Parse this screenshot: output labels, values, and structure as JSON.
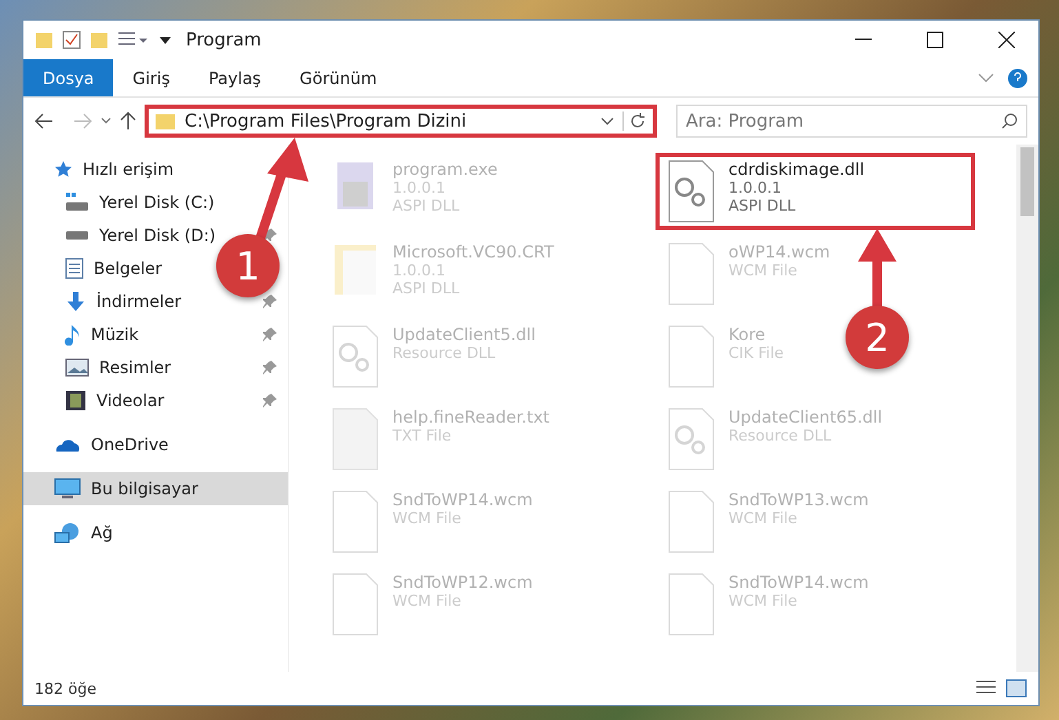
{
  "window": {
    "title": "Program"
  },
  "ribbon_tabs": [
    {
      "label": "Dosya",
      "selected": true
    },
    {
      "label": "Giriş",
      "selected": false
    },
    {
      "label": "Paylaş",
      "selected": false
    },
    {
      "label": "Görünüm",
      "selected": false
    }
  ],
  "address": {
    "value": "C:\\Program Files\\Program Dizini",
    "highlighted": true
  },
  "search": {
    "placeholder": "Ara: Program"
  },
  "sidebar": {
    "items": [
      {
        "label": "Hızlı erişim",
        "kind": "star",
        "selected": false,
        "children": [
          {
            "label": "Yerel Disk (C:)",
            "kind": "drive-windows",
            "pinned": false
          },
          {
            "label": "Yerel Disk (D:)",
            "kind": "drive",
            "pinned": true
          },
          {
            "label": "Belgeler",
            "kind": "document",
            "pinned": false
          },
          {
            "label": "İndirmeler",
            "kind": "download",
            "pinned": true
          },
          {
            "label": "Müzik",
            "kind": "music",
            "pinned": true
          },
          {
            "label": "Resimler",
            "kind": "picture",
            "pinned": true
          },
          {
            "label": "Videolar",
            "kind": "video",
            "pinned": true
          }
        ]
      },
      {
        "label": "OneDrive",
        "kind": "cloud",
        "selected": false
      },
      {
        "label": "Bu bilgisayar",
        "kind": "computer",
        "selected": true
      },
      {
        "label": "Ağ",
        "kind": "network",
        "selected": false
      }
    ]
  },
  "files": [
    {
      "name": "program.exe",
      "lines": [
        "1.0.0.1",
        "ASPI DLL"
      ],
      "kind": "exe",
      "faded": true,
      "highlighted": false
    },
    {
      "name": "cdrdiskimage.dll",
      "lines": [
        "1.0.0.1",
        "ASPI DLL"
      ],
      "kind": "gear",
      "faded": false,
      "highlighted": true
    },
    {
      "name": "Microsoft.VC90.CRT",
      "lines": [
        "1.0.0.1",
        "ASPI DLL"
      ],
      "kind": "folder",
      "faded": true,
      "highlighted": false
    },
    {
      "name": "oWP14.wcm",
      "lines": [
        "WCM File"
      ],
      "kind": "blank",
      "faded": true,
      "highlighted": false
    },
    {
      "name": "UpdateClient5.dll",
      "lines": [
        "Resource DLL"
      ],
      "kind": "gear",
      "faded": true,
      "highlighted": false
    },
    {
      "name": "Kore",
      "lines": [
        "CIK File"
      ],
      "kind": "blank",
      "faded": true,
      "highlighted": false
    },
    {
      "name": "help.fineReader.txt",
      "lines": [
        "TXT File"
      ],
      "kind": "text",
      "faded": true,
      "highlighted": false
    },
    {
      "name": "UpdateClient65.dll",
      "lines": [
        "Resource DLL"
      ],
      "kind": "gear",
      "faded": true,
      "highlighted": false
    },
    {
      "name": "SndToWP14.wcm",
      "lines": [
        "WCM File"
      ],
      "kind": "blank",
      "faded": true,
      "highlighted": false
    },
    {
      "name": "SndToWP13.wcm",
      "lines": [
        "WCM File"
      ],
      "kind": "blank",
      "faded": true,
      "highlighted": false
    },
    {
      "name": "SndToWP12.wcm",
      "lines": [
        "WCM File"
      ],
      "kind": "blank",
      "faded": true,
      "highlighted": false
    },
    {
      "name": "SndToWP14.wcm",
      "lines": [
        "WCM File"
      ],
      "kind": "blank",
      "faded": true,
      "highlighted": false
    }
  ],
  "status_bar": {
    "count": "182 öğe"
  },
  "callouts": [
    {
      "number": "1"
    },
    {
      "number": "2"
    }
  ]
}
